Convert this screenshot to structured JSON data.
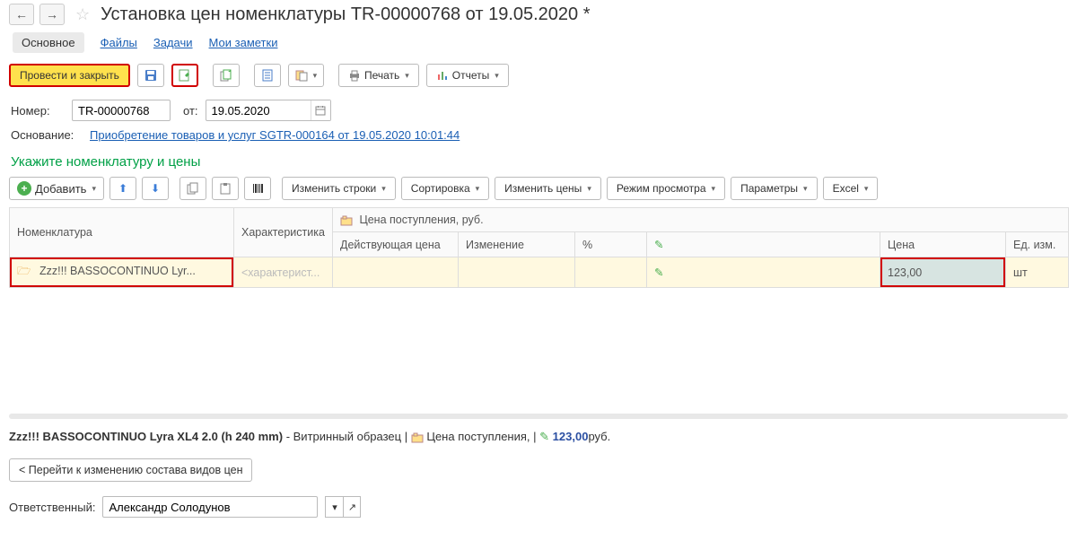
{
  "header": {
    "title": "Установка цен номенклатуры TR-00000768 от 19.05.2020 *"
  },
  "tabs": {
    "main": "Основное",
    "files": "Файлы",
    "tasks": "Задачи",
    "notes": "Мои заметки"
  },
  "toolbar": {
    "post_close": "Провести и закрыть",
    "print": "Печать",
    "reports": "Отчеты"
  },
  "form": {
    "number_label": "Номер:",
    "number_value": "TR-00000768",
    "from_label": "от:",
    "date_value": "19.05.2020",
    "basis_label": "Основание:",
    "basis_link": "Приобретение товаров и услуг SGTR-000164 от 19.05.2020 10:01:44"
  },
  "section_title": "Укажите номенклатуру и цены",
  "toolbar2": {
    "add": "Добавить",
    "edit_rows": "Изменить строки",
    "sort": "Сортировка",
    "edit_prices": "Изменить цены",
    "view_mode": "Режим просмотра",
    "params": "Параметры",
    "excel": "Excel"
  },
  "grid": {
    "headers": {
      "nomenclature": "Номенклатура",
      "characteristic": "Характеристика",
      "price_in": "Цена поступления, руб.",
      "current_price": "Действующая цена",
      "change": "Изменение",
      "percent": "%",
      "price": "Цена",
      "unit": "Ед. изм."
    },
    "row": {
      "nomenclature": "Zzz!!! BASSOCONTINUO Lyr...",
      "characteristic_ph": "<характерист...",
      "price": "123,00",
      "unit": "шт"
    }
  },
  "status": {
    "name": "Zzz!!! BASSOCONTINUO Lyra XL4 2.0 (h 240 mm)",
    "variant": " - Витринный образец",
    "price_label": "Цена поступления,",
    "price_val": "123,00",
    "price_cur": "руб."
  },
  "lower": {
    "goto_btn": "< Перейти к изменению состава видов цен",
    "responsible_label": "Ответственный:",
    "responsible_value": "Александр Солодунов"
  }
}
